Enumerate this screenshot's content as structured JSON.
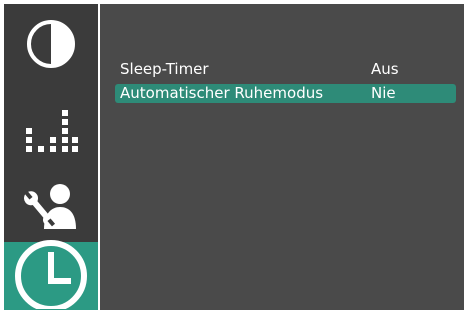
{
  "sidebar": {
    "items": [
      {
        "icon": "contrast-icon",
        "active": false
      },
      {
        "icon": "equalizer-icon",
        "active": false
      },
      {
        "icon": "service-wrench-user-icon",
        "active": false
      },
      {
        "icon": "clock-icon",
        "active": true
      }
    ]
  },
  "menu": {
    "rows": [
      {
        "label": "Sleep-Timer",
        "value": "Aus",
        "selected": false
      },
      {
        "label": "Automatischer Ruhemodus",
        "value": "Nie",
        "selected": true
      }
    ]
  },
  "colors": {
    "sidebar_bg": "#3b3b3b",
    "panel_bg": "#4a4a4a",
    "accent": "#2c9a84",
    "selection": "#2e8b78",
    "text": "#ffffff"
  }
}
